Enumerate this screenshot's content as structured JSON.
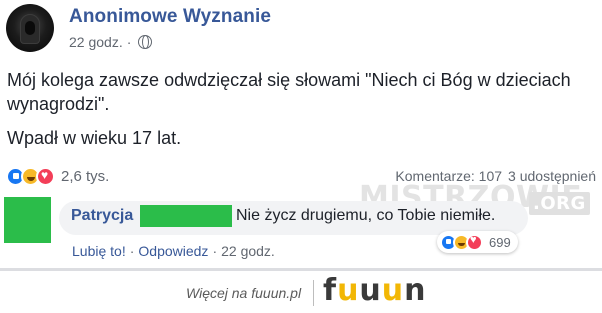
{
  "post": {
    "page_name": "Anonimowe Wyznanie",
    "time": "22 godz.",
    "separator": "·",
    "privacy_icon": "globe-icon",
    "text_lines": [
      "Mój kolega zawsze odwdzięczał się słowami \"Niech ci Bóg w dzieciach wynagrodzi\".",
      "Wpadł w wieku 17 lat."
    ],
    "reactions": {
      "icons": [
        "like-icon",
        "haha-icon",
        "love-icon"
      ],
      "count": "2,6 tys."
    },
    "comments_label": "Komentarze: 107",
    "shares_label": "3 udostępnień"
  },
  "watermark": {
    "main": "MISTRZOWIE",
    "suffix": ".ORG"
  },
  "comment": {
    "author": "Patrycja",
    "text": "Nie życz drugiemu, co Tobie niemiłe.",
    "reaction_count": "699",
    "like_label": "Lubię to!",
    "reply_label": "Odpowiedz",
    "separator": "·",
    "time": "22 godz."
  },
  "footer": {
    "text": "Więcej na fuuun.pl",
    "logo_letters": [
      "f",
      "u",
      "u",
      "u",
      "n"
    ]
  },
  "colors": {
    "link_blue": "#385898",
    "secondary_text": "#616770",
    "redaction_green": "#2bbd4a",
    "logo_yellow": "#f2b705"
  }
}
